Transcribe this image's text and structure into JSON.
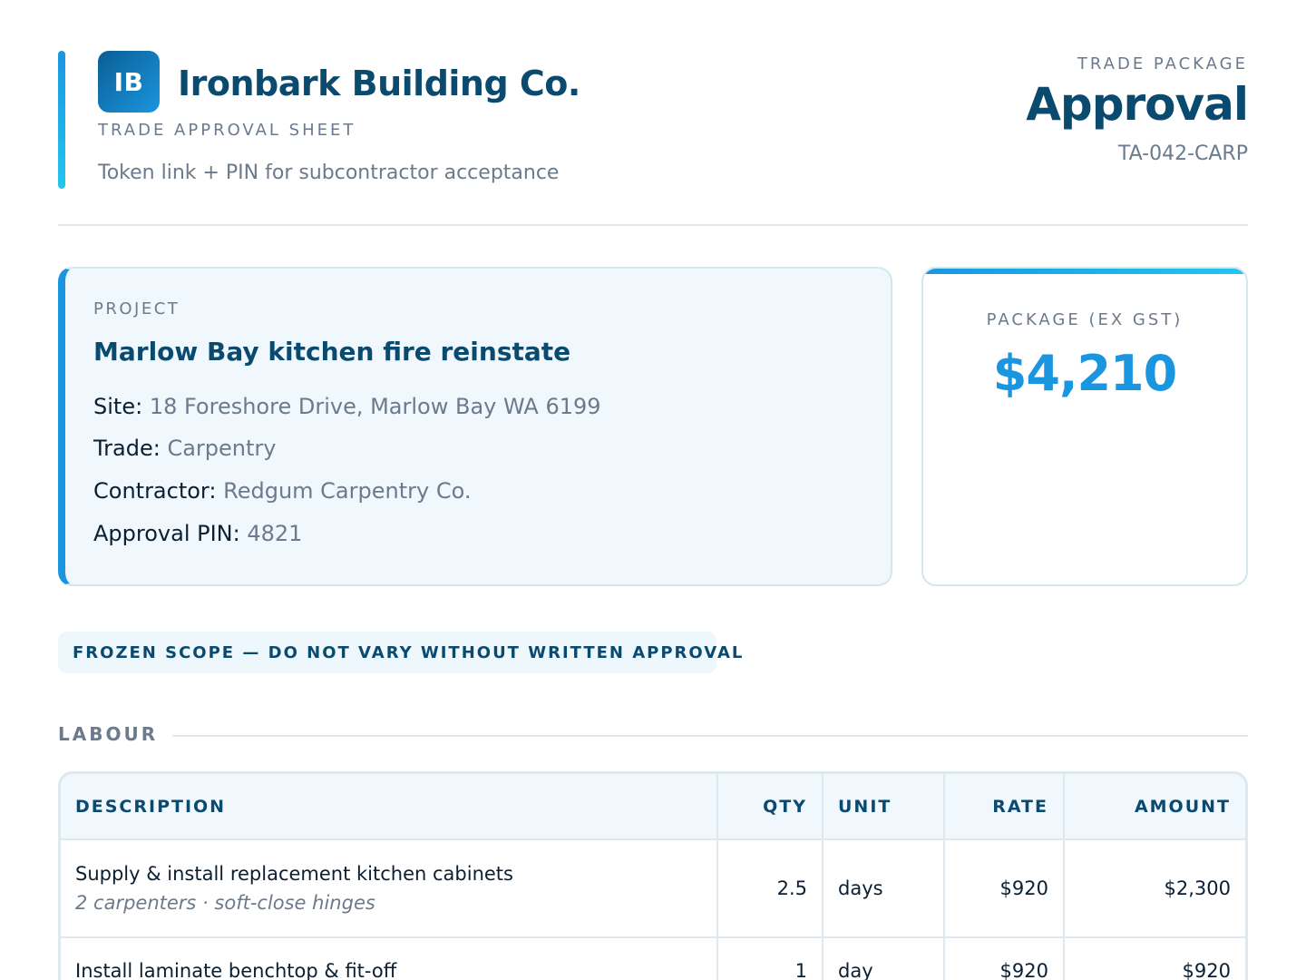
{
  "header": {
    "logo_initials": "IB",
    "company": "Ironbark Building Co.",
    "sheet_label": "TRADE APPROVAL SHEET",
    "subtitle": "Token link + PIN for subcontractor acceptance",
    "package_label": "TRADE PACKAGE",
    "title": "Approval",
    "reference": "TA-042-CARP"
  },
  "project": {
    "label": "PROJECT",
    "title": "Marlow Bay kitchen fire reinstate",
    "fields": [
      {
        "key": "Site:",
        "value": "18 Foreshore Drive, Marlow Bay WA 6199"
      },
      {
        "key": "Trade:",
        "value": "Carpentry"
      },
      {
        "key": "Contractor:",
        "value": "Redgum Carpentry Co."
      },
      {
        "key": "Approval PIN:",
        "value": "4821"
      }
    ]
  },
  "package": {
    "label": "PACKAGE (EX GST)",
    "amount": "$4,210"
  },
  "notice": "FROZEN SCOPE — DO NOT VARY WITHOUT WRITTEN APPROVAL",
  "section": {
    "label": "LABOUR",
    "columns": [
      "DESCRIPTION",
      "QTY",
      "UNIT",
      "RATE",
      "AMOUNT"
    ],
    "rows": [
      {
        "description": "Supply & install replacement kitchen cabinets",
        "note": "2 carpenters · soft-close hinges",
        "qty": "2.5",
        "unit": "days",
        "rate": "$920",
        "amount": "$2,300"
      },
      {
        "description": "Install laminate benchtop & fit-off",
        "note": "",
        "qty": "1",
        "unit": "day",
        "rate": "$920",
        "amount": "$920"
      }
    ]
  },
  "colors": {
    "brand_dark": "#0b4a6f",
    "brand_accent": "#1a96e0",
    "muted_text": "#6b7a8c"
  }
}
